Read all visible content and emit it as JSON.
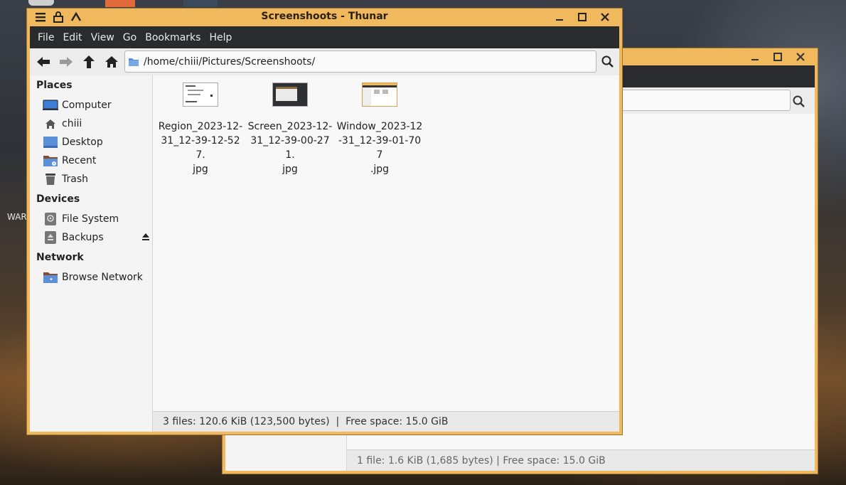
{
  "desktop": {
    "partial_label": "WAR"
  },
  "window_main": {
    "title": "Screenshoots - Thunar",
    "menu": [
      "File",
      "Edit",
      "View",
      "Go",
      "Bookmarks",
      "Help"
    ],
    "location_path": "/home/chiii/Pictures/Screenshoots/",
    "sidebar": {
      "places_heading": "Places",
      "places": [
        "Computer",
        "chiii",
        "Desktop",
        "Recent",
        "Trash"
      ],
      "devices_heading": "Devices",
      "devices": [
        "File System",
        "Backups"
      ],
      "network_heading": "Network",
      "network": [
        "Browse Network"
      ]
    },
    "files": [
      {
        "name": "Region_2023-12-31_12-39-12-527.jpg",
        "name_lines": [
          "Region_2023-12-",
          "31_12-39-12-527.",
          "jpg"
        ]
      },
      {
        "name": "Screen_2023-12-31_12-39-00-271.jpg",
        "name_lines": [
          "Screen_2023-12-",
          "31_12-39-00-271.",
          "jpg"
        ]
      },
      {
        "name": "Window_2023-12-31_12-39-01-707.jpg",
        "name_lines": [
          "Window_2023-12",
          "-31_12-39-01-707",
          ".jpg"
        ]
      }
    ],
    "status": "3 files: 120.6 KiB (123,500 bytes)  |  Free space: 15.0 GiB"
  },
  "window_back": {
    "status": "1 file: 1.6 KiB (1,685 bytes)  |  Free space: 15.0 GiB"
  },
  "colors": {
    "window_frame": "#f0b95e",
    "menubar": "#2a2b2d",
    "folder_blue": "#5b8fd9"
  }
}
